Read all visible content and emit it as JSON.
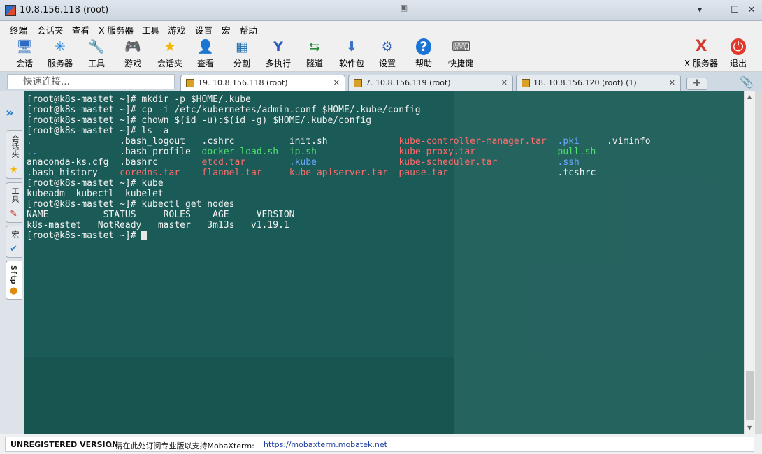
{
  "window": {
    "title": "10.8.156.118 (root)"
  },
  "menu": [
    "终端",
    "会话夹",
    "查看",
    "X 服务器",
    "工具",
    "游戏",
    "设置",
    "宏",
    "帮助"
  ],
  "toolbar": {
    "left": [
      {
        "label": "会话",
        "icon": "🖥"
      },
      {
        "label": "服务器",
        "icon": "✳"
      },
      {
        "label": "工具",
        "icon": "🔧"
      },
      {
        "label": "游戏",
        "icon": "🎮"
      },
      {
        "label": "会话夹",
        "icon": "★"
      },
      {
        "label": "查看",
        "icon": "👤"
      },
      {
        "label": "分割",
        "icon": "▦"
      },
      {
        "label": "多执行",
        "icon": "Y"
      },
      {
        "label": "隧道",
        "icon": "⇆"
      },
      {
        "label": "软件包",
        "icon": "⬇"
      },
      {
        "label": "设置",
        "icon": "⚙"
      },
      {
        "label": "帮助",
        "icon": "?"
      },
      {
        "label": "快捷键",
        "icon": "⌨"
      }
    ],
    "right": [
      {
        "label": "X 服务器",
        "icon": "X"
      },
      {
        "label": "退出",
        "icon": "⏻"
      }
    ]
  },
  "quick_connect": {
    "placeholder": "快速连接..."
  },
  "tabs": [
    {
      "label": "19. 10.8.156.118 (root)",
      "active": true
    },
    {
      "label": "7. 10.8.156.119 (root)",
      "active": false
    },
    {
      "label": "18. 10.8.156.120 (root) (1)",
      "active": false
    }
  ],
  "sidebar_tabs": [
    "会话夹",
    "工具",
    "宏",
    "Sftp"
  ],
  "terminal": {
    "lines": [
      [
        {
          "t": "[root@k8s-mastet ~]# mkdir -p $HOME/.kube",
          "c": "norm",
          "col": 0
        }
      ],
      [
        {
          "t": "[root@k8s-mastet ~]# cp -i /etc/kubernetes/admin.conf $HOME/.kube/config",
          "c": "norm",
          "col": 0
        }
      ],
      [
        {
          "t": "[root@k8s-mastet ~]# chown $(id -u):$(id -g) $HOME/.kube/config",
          "c": "norm",
          "col": 0
        }
      ],
      [
        {
          "t": "[root@k8s-mastet ~]# ls -a",
          "c": "norm",
          "col": 0
        }
      ],
      [
        {
          "t": ".",
          "c": "dir",
          "col": 0
        },
        {
          "t": ".bash_logout",
          "c": "norm",
          "col": 17
        },
        {
          "t": ".cshrc",
          "c": "norm",
          "col": 32
        },
        {
          "t": "init.sh",
          "c": "norm",
          "col": 48
        },
        {
          "t": "kube-controller-manager.tar",
          "c": "arc",
          "col": 68
        },
        {
          "t": ".pki",
          "c": "dir",
          "col": 97
        },
        {
          "t": ".viminfo",
          "c": "norm",
          "col": 106
        }
      ],
      [
        {
          "t": "..",
          "c": "dir",
          "col": 0
        },
        {
          "t": ".bash_profile",
          "c": "norm",
          "col": 17
        },
        {
          "t": "docker-load.sh",
          "c": "exe",
          "col": 32
        },
        {
          "t": "ip.sh",
          "c": "exe",
          "col": 48
        },
        {
          "t": "kube-proxy.tar",
          "c": "arc",
          "col": 68
        },
        {
          "t": "pull.sh",
          "c": "exe",
          "col": 97
        }
      ],
      [
        {
          "t": "anaconda-ks.cfg",
          "c": "norm",
          "col": 0
        },
        {
          "t": ".bashrc",
          "c": "norm",
          "col": 17
        },
        {
          "t": "etcd.tar",
          "c": "arc",
          "col": 32
        },
        {
          "t": ".kube",
          "c": "dir",
          "col": 48
        },
        {
          "t": "kube-scheduler.tar",
          "c": "arc",
          "col": 68
        },
        {
          "t": ".ssh",
          "c": "dir",
          "col": 97
        }
      ],
      [
        {
          "t": ".bash_history",
          "c": "norm",
          "col": 0
        },
        {
          "t": "coredns.tar",
          "c": "arc",
          "col": 17
        },
        {
          "t": "flannel.tar",
          "c": "arc",
          "col": 32
        },
        {
          "t": "kube-apiserver.tar",
          "c": "arc",
          "col": 48
        },
        {
          "t": "pause.tar",
          "c": "arc",
          "col": 68
        },
        {
          "t": ".tcshrc",
          "c": "norm",
          "col": 97
        }
      ],
      [
        {
          "t": "[root@k8s-mastet ~]# kube",
          "c": "norm",
          "col": 0
        }
      ],
      [
        {
          "t": "kubeadm  kubectl  kubelet",
          "c": "norm",
          "col": 0
        }
      ],
      [
        {
          "t": "[root@k8s-mastet ~]# kubectl get nodes",
          "c": "norm",
          "col": 0
        }
      ],
      [
        {
          "t": "NAME          STATUS     ROLES    AGE     VERSION",
          "c": "norm",
          "col": 0
        }
      ],
      [
        {
          "t": "k8s-mastet   NotReady   master   3m13s   v1.19.1",
          "c": "norm",
          "col": 0
        }
      ],
      [
        {
          "t": "[root@k8s-mastet ~]# ",
          "c": "norm",
          "col": 0,
          "cursor": true
        }
      ]
    ]
  },
  "status": {
    "unregistered": "UNREGISTERED VERSION",
    "message": " - 请在此处订阅专业版以支持MobaXterm: ",
    "url": "https://mobaxterm.mobatek.net"
  }
}
